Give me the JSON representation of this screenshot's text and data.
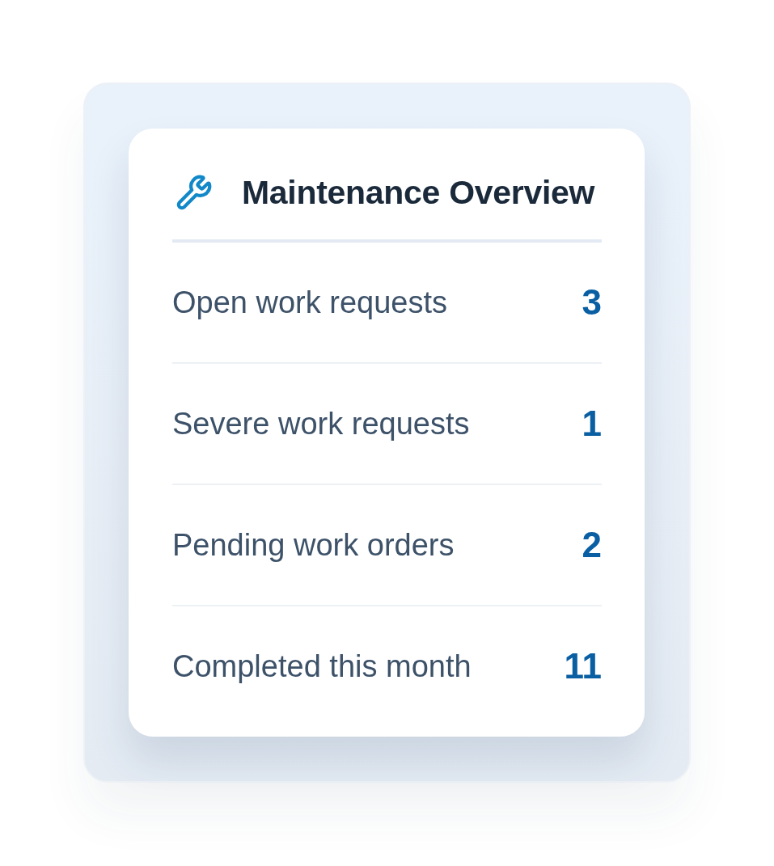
{
  "card": {
    "title": "Maintenance Overview"
  },
  "stats": [
    {
      "label": "Open work requests",
      "value": "3"
    },
    {
      "label": "Severe work requests",
      "value": "1"
    },
    {
      "label": "Pending work orders",
      "value": "2"
    },
    {
      "label": "Completed this month",
      "value": "11"
    }
  ]
}
